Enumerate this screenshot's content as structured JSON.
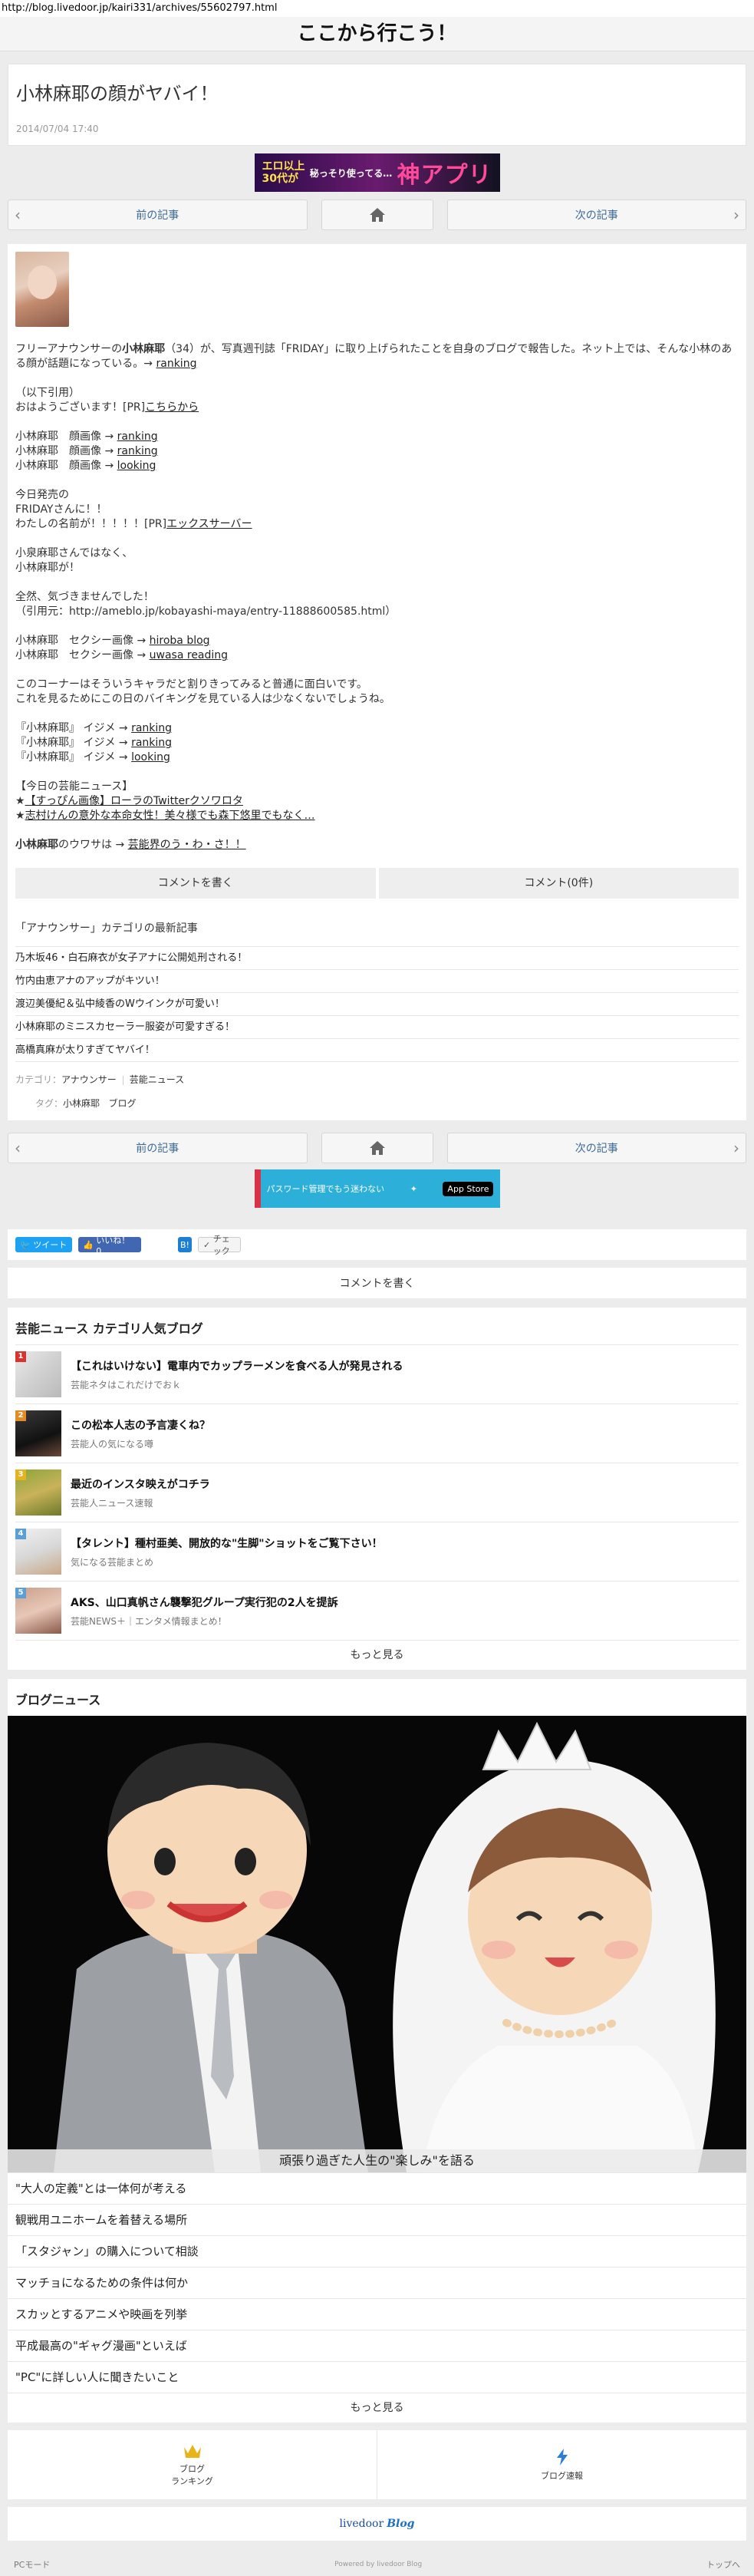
{
  "url": "http://blog.livedoor.jp/kairi331/archives/55602797.html",
  "site_title": "ここから行こう！",
  "article": {
    "title": "小林麻耶の顔がヤバイ！",
    "date": "2014/07/04 17:40"
  },
  "ad1": {
    "line1": "エロ以上",
    "line2": "30代が",
    "middle": "秘っそり使ってる…",
    "big": "神アプリ"
  },
  "nav": {
    "prev": "前の記事",
    "next": "次の記事"
  },
  "body": {
    "intro_prefix": "フリーアナウンサーの",
    "intro_name": "小林麻耶",
    "intro_rest": "（34）が、写真週刊誌「FRIDAY」に取り上げられたことを自身のブログで報告した。ネット上では、そんな小林のある顔が話題になっている。→",
    "intro_link": "ranking",
    "quote_note": "（以下引用）",
    "greeting": "おはようございます！[PR]",
    "greeting_link": "こちらから",
    "lines1": [
      {
        "label": "小林麻耶　顔画像 → ",
        "link": "ranking"
      },
      {
        "label": "小林麻耶　顔画像 → ",
        "link": "ranking"
      },
      {
        "label": "小林麻耶　顔画像 → ",
        "link": "looking"
      }
    ],
    "p_friday_1": "今日発売の",
    "p_friday_2": "FRIDAYさんに！！",
    "p_friday_3": "わたしの名前が！！！！！[PR]",
    "p_friday_link": "エックスサーバー",
    "p_kobayashi_1": "小泉麻耶さんではなく、",
    "p_kobayashi_2": "小林麻耶が！",
    "p_kizuki_1": "全然、気づきませんでした！",
    "p_kizuki_2": "（引用元：http://ameblo.jp/kobayashi-maya/entry-11888600585.html）",
    "lines2": [
      {
        "label": "小林麻耶　セクシー画像 → ",
        "link": "hiroba blog"
      },
      {
        "label": "小林麻耶　セクシー画像 → ",
        "link": "uwasa reading"
      }
    ],
    "p_corner_1": "このコーナーはそういうキャラだと割りきってみると普通に面白いです。",
    "p_corner_2": "これを見るためにこの日のバイキングを見ている人は少なくないでしょうね。",
    "lines3": [
      {
        "label": "『小林麻耶』 イジメ → ",
        "link": "ranking"
      },
      {
        "label": "『小林麻耶』 イジメ → ",
        "link": "ranking"
      },
      {
        "label": "『小林麻耶』 イジメ → ",
        "link": "looking"
      }
    ],
    "today_head": "【今日の芸能ニュース】",
    "today_1": "【すっぴん画像】ローラのTwitterクソワロタ",
    "today_2": "志村けんの意外な本命女性！美々様でも森下悠里でもなく…",
    "rumor_name": "小林麻耶",
    "rumor_rest": "のウワサは → ",
    "rumor_link": "芸能界のう・わ・さ！！"
  },
  "cta": {
    "write": "コメントを書く",
    "count": "コメント(0件)"
  },
  "latest": {
    "heading": "「アナウンサー」カテゴリの最新記事",
    "items": [
      "乃木坂46・白石麻衣が女子アナに公開処刑される！",
      "竹内由恵アナのアップがキツい！",
      "渡辺美優紀＆弘中綾香のWウインクが可愛い！",
      "小林麻耶のミニスカセーラー服姿が可愛すぎる！",
      "高橋真麻が太りすぎてヤバイ！"
    ]
  },
  "meta": {
    "category_label": "カテゴリ：",
    "category_1": "アナウンサー",
    "category_2": "芸能ニュース",
    "tag_label": "タグ：",
    "tag_1": "小林麻耶",
    "tag_2": "ブログ"
  },
  "ad2": {
    "text": "パスワード管理でもう迷わない",
    "store": "App Store"
  },
  "social": {
    "tweet": "ツイート",
    "like": "いいね！ 0",
    "hatena": "B!",
    "check": "チェック"
  },
  "comment_bar": "コメントを書く",
  "rank": {
    "heading": "芸能ニュース カテゴリ人気ブログ",
    "items": [
      {
        "num": "1",
        "title": "【これはいけない】電車内でカップラーメンを食べる人が発見される",
        "sub": "芸能ネタはこれだけでおｋ",
        "color": "#d9332f"
      },
      {
        "num": "2",
        "title": "この松本人志の予言凄くね？",
        "sub": "芸能人の気になる噂",
        "color": "#e28a24"
      },
      {
        "num": "3",
        "title": "最近のインスタ映えがコチラ",
        "sub": "芸能人ニュース速報",
        "color": "#e6b21d"
      },
      {
        "num": "4",
        "title": "【タレント】種村亜美、開放的な\"生脚\"ショットをご覧下さい！",
        "sub": "気になる芸能まとめ",
        "color": "#5a9fd6"
      },
      {
        "num": "5",
        "title": "AKS、山口真帆さん襲撃犯グループ実行犯の2人を提訴",
        "sub": "芸能NEWS＋｜エンタメ情報まとめ！",
        "color": "#5a9fd6"
      }
    ],
    "more": "もっと見る"
  },
  "news": {
    "heading": "ブログニュース",
    "caption": "頑張り過ぎた人生の\"楽しみ\"を語る",
    "items": [
      "\"大人の定義\"とは一体何が考える",
      "観戦用ユニホームを着替える場所",
      "「スタジャン」の購入について相談",
      "マッチョになるための条件は何か",
      "スカッとするアニメや映画を列挙",
      "平成最高の\"ギャグ漫画\"といえば",
      "\"PC\"に詳しい人に聞きたいこと"
    ],
    "more": "もっと見る"
  },
  "footer_nav": {
    "ranking": "ブログ\nランキング",
    "ranking_line1": "ブログ",
    "ranking_line2": "ランキング",
    "news": "ブログ速報"
  },
  "logo": {
    "a": "livedoor",
    "b": "Blog"
  },
  "bottom": {
    "pc": "PCモード",
    "powered": "Powered by livedoor Blog",
    "top": "トップへ"
  }
}
